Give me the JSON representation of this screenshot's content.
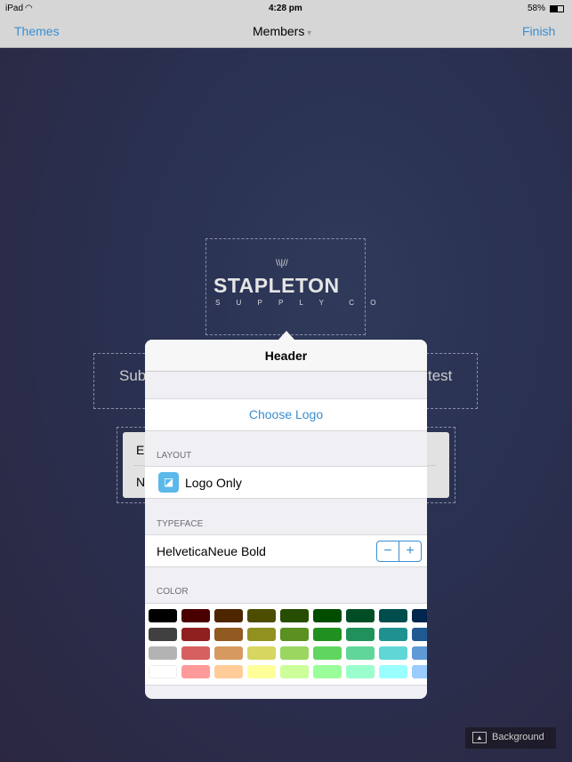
{
  "status_bar": {
    "device": "iPad",
    "time": "4:28 pm",
    "battery": "58%"
  },
  "nav": {
    "left": "Themes",
    "title": "Members",
    "right": "Finish"
  },
  "canvas": {
    "logo_main": "STAPLETON",
    "logo_sub": "S U P P L Y  C O",
    "subtitle_left": "Sub",
    "subtitle_right": "test",
    "field1": "E",
    "field2": "N"
  },
  "popover": {
    "title": "Header",
    "choose_logo": "Choose Logo",
    "layout_label": "LAYOUT",
    "layout_value": "Logo Only",
    "typeface_label": "TYPEFACE",
    "typeface_value": "HelveticaNeue Bold",
    "minus": "−",
    "plus": "+",
    "color_label": "COLOR",
    "colors": [
      [
        "#000000",
        "#4a0000",
        "#4d2600",
        "#4d4d00",
        "#264d00",
        "#004d00",
        "#004d26",
        "#004d4d",
        "#00264d"
      ],
      [
        "#404040",
        "#902020",
        "#915a20",
        "#919120",
        "#5a9120",
        "#209120",
        "#20915a",
        "#209191",
        "#205a91"
      ],
      [
        "#b3b3b3",
        "#d66060",
        "#d69a60",
        "#d6d660",
        "#9ad660",
        "#60d660",
        "#60d69a",
        "#60d6d6",
        "#609ad6"
      ],
      [
        "#ffffff",
        "#ff9a9a",
        "#ffcc9a",
        "#ffff9a",
        "#ccff9a",
        "#9aff9a",
        "#9affcc",
        "#9affff",
        "#9accff"
      ]
    ]
  },
  "background_button": "Background"
}
